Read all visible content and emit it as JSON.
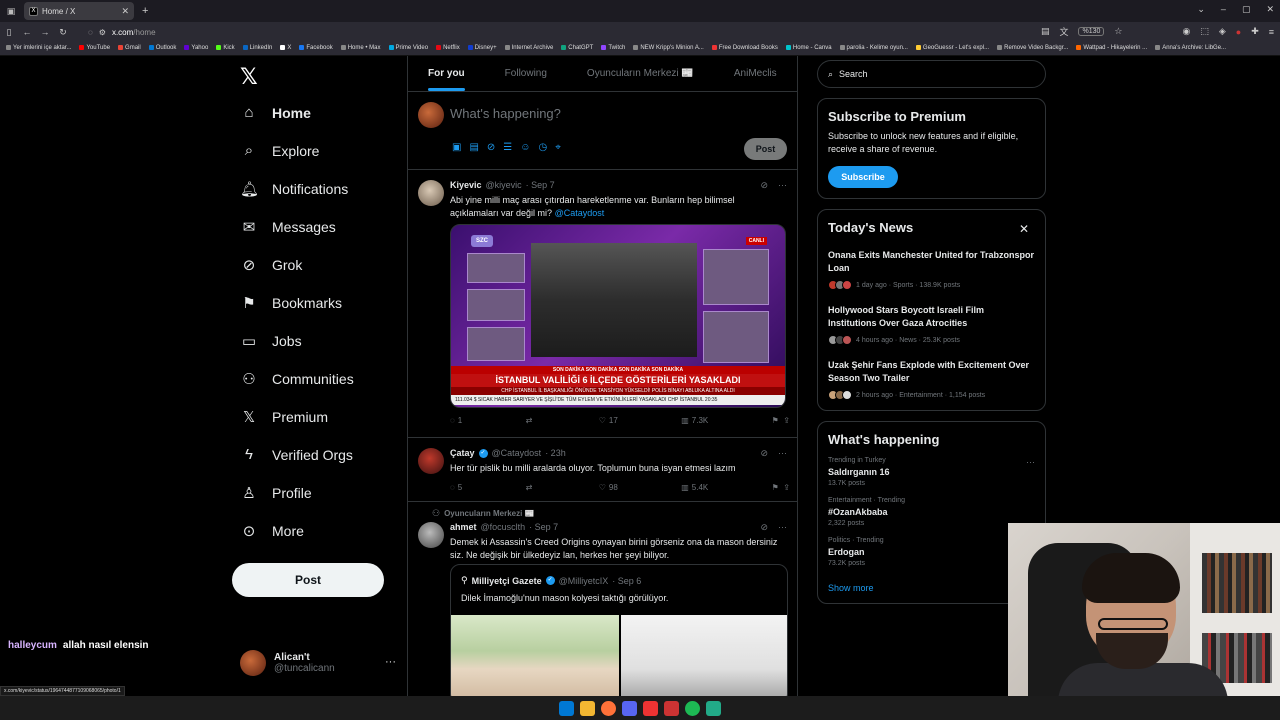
{
  "browser": {
    "tab_title": "Home / X",
    "url_host": "x.com",
    "url_path": "/home",
    "zoom": "%130"
  },
  "bookmarks": [
    "Yer imlerini içe aktar...",
    "YouTube",
    "Gmail",
    "Outlook",
    "Yahoo",
    "Kick",
    "LinkedIn",
    "X",
    "Facebook",
    "Home • Max",
    "Prime Video",
    "Netflix",
    "Disney+",
    "Internet Archive",
    "ChatGPT",
    "Twitch",
    "NEW Kripp's Minion A...",
    "Free Download Books",
    "Home - Canva",
    "parolia - Kelime oyun...",
    "GeoGuessr - Let's expl...",
    "Remove Video Backgr...",
    "Wattpad - Hikayelerin ...",
    "Anna's Archive: LibGe..."
  ],
  "nav": {
    "items": [
      {
        "label": "Home",
        "icon": "home-icon"
      },
      {
        "label": "Explore",
        "icon": "search-icon"
      },
      {
        "label": "Notifications",
        "icon": "bell-icon"
      },
      {
        "label": "Messages",
        "icon": "mail-icon"
      },
      {
        "label": "Grok",
        "icon": "grok-icon"
      },
      {
        "label": "Bookmarks",
        "icon": "bookmark-icon"
      },
      {
        "label": "Jobs",
        "icon": "briefcase-icon"
      },
      {
        "label": "Communities",
        "icon": "people-icon"
      },
      {
        "label": "Premium",
        "icon": "x-icon"
      },
      {
        "label": "Verified Orgs",
        "icon": "lightning-icon"
      },
      {
        "label": "Profile",
        "icon": "person-icon"
      },
      {
        "label": "More",
        "icon": "more-circle-icon"
      }
    ],
    "post_label": "Post"
  },
  "account": {
    "name": "Alican't",
    "handle": "@tuncalicann"
  },
  "chat_overlay": {
    "user": "halleycum",
    "message": "allah nasıl elensin"
  },
  "status_url": "x.com/kiyevic/status/1964744877109068065/photo/1",
  "timeline": {
    "tabs": [
      "For you",
      "Following",
      "Oyuncuların Merkezi 📰",
      "AniMeclis"
    ],
    "compose_placeholder": "What's happening?",
    "post_label": "Post",
    "tweets": [
      {
        "name": "Kiyevic",
        "handle": "@kiyevic",
        "time": "· Sep 7",
        "text": "Abi yine milli maç arası çıtırdan hareketlenme var. Bunların hep bilimsel açıklamaları var değil mi?",
        "mention": "@Cataydost",
        "media": {
          "logo": "SZC",
          "live": "CANLI",
          "ticker1": "SON DAKİKA   SON DAKİKA   SON DAKİKA   SON DAKİKA",
          "headline": "İSTANBUL VALİLİĞİ 6 İLÇEDE GÖSTERİLERİ YASAKLADI",
          "sub": "CHP İSTANBUL İL BAŞKANLIĞI ÖNÜNDE TANSİYON YÜKSELDİ! POLİS BİNAYI ABLUKA ALTINA ALDI",
          "bottom": "111.034 $   SICAK HABER   SARIYER VE ŞİŞLİ'DE TÜM EYLEM VE ETKİNLİKLERİ YASAKLADI   CHP İSTANBUL   20:35"
        },
        "replies": "1",
        "reposts": "",
        "likes": "17",
        "views": "7.3K"
      },
      {
        "name": "Çatay",
        "handle": "@Cataydost",
        "time": "· 23h",
        "text": "Her tür pislik bu milli aralarda oluyor. Toplumun buna isyan etmesi lazım",
        "replies": "5",
        "reposts": "",
        "likes": "98",
        "views": "5.4K"
      },
      {
        "context": "Oyuncuların Merkezi 📰",
        "name": "ahmet",
        "handle": "@focusclth",
        "time": "· Sep 7",
        "text": "Demek ki Assassin's Creed Origins oynayan birini görseniz ona da mason dersiniz siz. Ne değişik bir ülkedeyiz lan, herkes her şeyi biliyor.",
        "quote": {
          "name": "Milliyetçi Gazete",
          "handle": "@MilliyetcIX",
          "time": "· Sep 6",
          "text": "Dilek İmamoğlu'nun mason kolyesi taktığı görülüyor."
        }
      }
    ]
  },
  "right": {
    "search_placeholder": "Search",
    "premium": {
      "title": "Subscribe to Premium",
      "text": "Subscribe to unlock new features and if eligible, receive a share of revenue.",
      "button": "Subscribe"
    },
    "news": {
      "title": "Today's News",
      "items": [
        {
          "title": "Onana Exits Manchester United for Trabzonspor Loan",
          "meta": "1 day ago · Sports · 138.9K posts"
        },
        {
          "title": "Hollywood Stars Boycott Israeli Film Institutions Over Gaza Atrocities",
          "meta": "4 hours ago · News · 25.3K posts"
        },
        {
          "title": "Uzak Şehir Fans Explode with Excitement Over Season Two Trailer",
          "meta": "2 hours ago · Entertainment · 1,154 posts"
        }
      ]
    },
    "happening": {
      "title": "What's happening",
      "trends": [
        {
          "category": "Trending in Turkey",
          "name": "Saldırganın 16",
          "posts": "13.7K posts"
        },
        {
          "category": "Entertainment · Trending",
          "name": "#OzanAkbaba",
          "posts": "2,322 posts"
        },
        {
          "category": "Politics · Trending",
          "name": "Erdogan",
          "posts": "73.2K posts"
        }
      ],
      "show_more": "Show more"
    }
  },
  "colors": {
    "accent": "#1d9bf0",
    "background": "#000000",
    "border": "#2f3336",
    "muted": "#71767b"
  }
}
